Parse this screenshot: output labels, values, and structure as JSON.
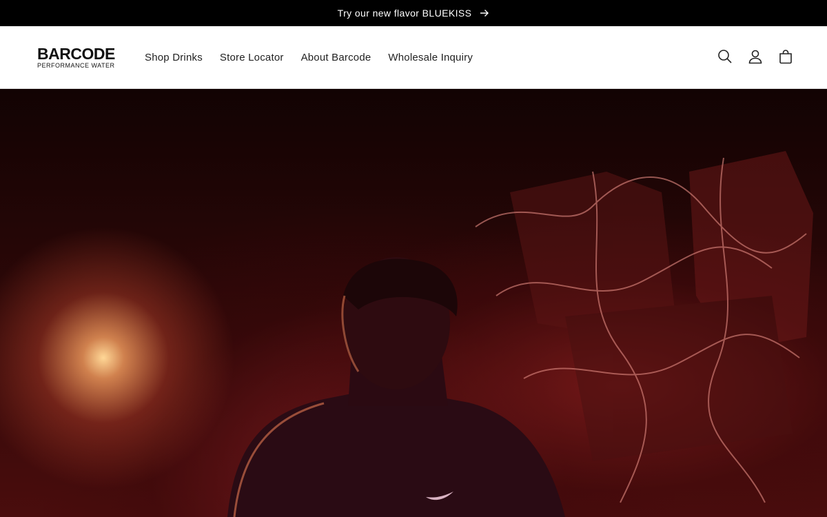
{
  "announcement": {
    "text": "Try our new flavor BLUEKISS",
    "arrow_icon": "arrow-right-icon"
  },
  "logo": {
    "name": "BARCODE",
    "tagline": "PERFORMANCE WATER"
  },
  "nav": {
    "items": [
      {
        "label": "Shop Drinks"
      },
      {
        "label": "Store Locator"
      },
      {
        "label": "About Barcode"
      },
      {
        "label": "Wholesale Inquiry"
      }
    ]
  },
  "header_icons": [
    "search-icon",
    "account-icon",
    "cart-icon"
  ],
  "hero": {
    "image": "athlete-in-red-light-video",
    "accent_color": "#4a0d0d"
  }
}
